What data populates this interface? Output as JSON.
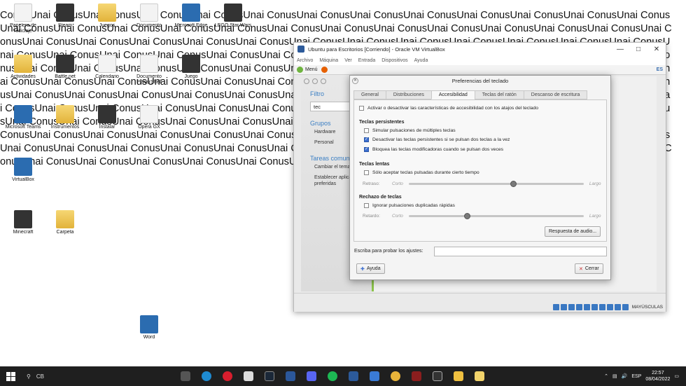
{
  "wallpaper": {
    "text": "ConusUnai ConusUnai ConusUnai ConusUnai ConusUnai ConusUnai ConusUnai ConusUnai ConusUnai ConusUnai ConusUnai ConusUnai ConusUnai ConusUnai ConusUnai ConusUnai ConusUnai ConusUnai ConusUnai ConusUnai ConusUnai ConusUnai ConusUnai ConusUnai ConusUnai ConusUnai ConusUnai ConusUnai ConusUnai ConusUnai ConusUnai ConusUnai ConusUnai ConusUnai ConusUnai ConusUnai ConusUnai ConusUnai ConusUnai ConusUnai ConusUnai ConusUnai ConusUnai ConusUnai ConusUnai ConusUnai ConusUnai ConusUnai ConusUnai ConusUnai ConusUnai ConusUnai ConusUnai ConusUnai ConusUnai ConusUnai ConusUnai ConusUnai ConusUnai ConusUnai ConusUnai ConusUnai ConusUnai ConusUnai ConusUnai ConusUnai ConusUnai ConusUnai ConusUnai ConusUnai ConusUnai ConusUnai ConusUnai ConusUnai ConusUnai ConusUnai ConusUnai ConusUnai ConusUnai ConusUnai ConusUnai ConusUnai ConusUnai ConusUnai ConusUnai ConusUnai ConusUnai ConusUnai ConusUnai ConusUnai ConusUnai ConusUnai ConusUnai ConusUnai ConusUnai ConusUnai ConusUnai ConusUnai ConusUnai ConusUnai ConusUnai ConusUnai ConusUnai ConusUnai ConusUnai ConusUnai ConusUnai ConusUnai ConusUnai ConusUnai ConusUnai ConusUnai ConusUnai ConusUnai ConusUnai ConusUnai ConusUnai ConusUnai ConusUnai ConusUnai ConusUnai ConusUnai ConusUnai ConusUnai ConusUnai ConusUnai ConusUnai ConusUnai ConusUnai ConusUnai ConusUnai ConusUnai ConusUnai ConusUnai ConusUnai ConusUnai ConusUnai ConusUnai ConusUnai ConusUnai ConusUnai ConusUnai ConusUnai ConusUnai Conus"
  },
  "desktop_icons": [
    {
      "label": "Papelera de reciclaje",
      "kind": "doc"
    },
    {
      "label": "Steam",
      "kind": "app-dark"
    },
    {
      "label": "Juegos",
      "kind": "folder"
    },
    {
      "label": "Documento",
      "kind": "doc"
    },
    {
      "label": "Microsoft Edge",
      "kind": "app-blue"
    },
    {
      "label": "LEGO Star Wars",
      "kind": "app-dark"
    },
    {
      "label": "Actividades",
      "kind": "folder"
    },
    {
      "label": "Battle.net",
      "kind": "app-dark"
    },
    {
      "label": "Calendario",
      "kind": "doc"
    },
    {
      "label": "Documento PowerShell",
      "kind": "doc"
    },
    {
      "label": "Juego",
      "kind": "app-dark"
    },
    {
      "label": "Microsoft Teams",
      "kind": "app-blue"
    },
    {
      "label": "Instrumentos",
      "kind": "folder"
    },
    {
      "label": "Instalar",
      "kind": "app-dark"
    },
    {
      "label": "Opera GX",
      "kind": "doc"
    },
    {
      "label": "VirtualBox",
      "kind": "app-blue"
    },
    {
      "label": "Minecraft",
      "kind": "app-dark"
    },
    {
      "label": "Carpeta",
      "kind": "folder"
    },
    {
      "label": "Word",
      "kind": "app-blue"
    }
  ],
  "vbox": {
    "title": "Ubuntu para Escritorios [Corriendo] - Oracle VM VirtualBox",
    "menu": [
      "Archivo",
      "Máquina",
      "Ver",
      "Entrada",
      "Dispositivos",
      "Ayuda"
    ],
    "host_key": "MAYÚSCULAS"
  },
  "guest": {
    "menu_label": "Menú",
    "keyboard_indicator": "ES"
  },
  "settings_sidebar": {
    "filter_heading": "Filtro",
    "search_value": "tec",
    "groups_heading": "Grupos",
    "groups": [
      "Hardware",
      "Personal"
    ],
    "tasks_heading": "Tareas comunes",
    "tasks": [
      "Cambiar el tema",
      "Establecer aplicaciones preferidas"
    ]
  },
  "dialog": {
    "title": "Preferencias del teclado",
    "tabs": [
      "General",
      "Distribuciones",
      "Accesibilidad",
      "Teclas del ratón",
      "Descanso de escritura"
    ],
    "active_tab": 2,
    "toggle_label": "Activar o desactivar las características de accesibilidad con los atajos del teclado",
    "toggle_checked": false,
    "sticky": {
      "heading": "Teclas persistentes",
      "options": [
        {
          "label": "Simular pulsaciones de múltiples teclas",
          "checked": false
        },
        {
          "label": "Desactivar las teclas persistentes si se pulsan dos teclas a la vez",
          "checked": true
        },
        {
          "label": "Bloquea las teclas modificadoras cuando se pulsan dos veces",
          "checked": true
        }
      ]
    },
    "slow": {
      "heading": "Teclas lentas",
      "option": "Sólo aceptar teclas pulsadas durante cierto tiempo",
      "checked": false,
      "slider_label": "Retraso:",
      "lo": "Corto",
      "hi": "Largo",
      "value": 0.6
    },
    "bounce": {
      "heading": "Rechazo de teclas",
      "option": "Ignorar pulsaciones duplicadas rápidas",
      "checked": false,
      "slider_label": "Retardo:",
      "lo": "Corto",
      "hi": "Largo",
      "value": 0.33
    },
    "audio_button": "Respuesta de audio...",
    "test_label": "Escriba para probar los ajustes:",
    "test_value": "",
    "help_button": "Ayuda",
    "close_button": "Cerrar"
  },
  "taskbar": {
    "search_text": "CB",
    "language": "ESP",
    "time": "22:57",
    "date": "08/04/2022"
  },
  "colors": {
    "accent": "#3c6fd0",
    "mint_green": "#8bc34a",
    "taskbar": "#1f1f1f"
  }
}
